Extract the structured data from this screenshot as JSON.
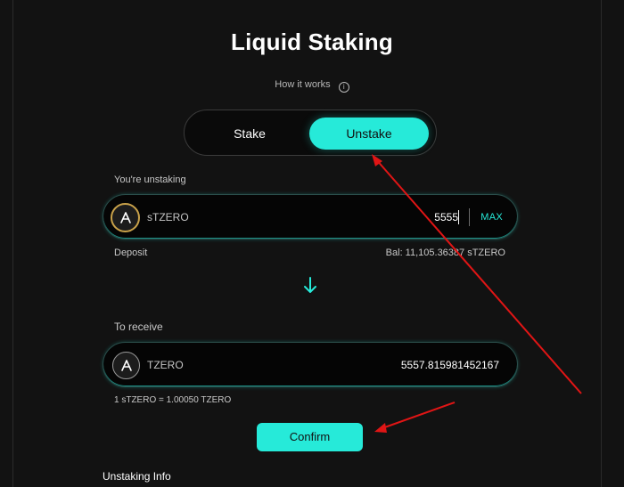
{
  "page": {
    "title": "Liquid Staking",
    "how_it_works": "How it works",
    "info_icon": "i"
  },
  "toggle": {
    "stake_label": "Stake",
    "unstake_label": "Unstake",
    "active": "Unstake"
  },
  "unstake_field": {
    "label": "You're unstaking",
    "token": "sTZERO",
    "value": "5555",
    "max_label": "MAX",
    "footer_left": "Deposit",
    "footer_right": "Bal: 11,105.36387 sTZERO"
  },
  "receive_field": {
    "label": "To receive",
    "token": "TZERO",
    "value": "5557.815981452167",
    "rate": "1 sTZERO = 1.00050 TZERO"
  },
  "confirm_label": "Confirm",
  "section_title": "Unstaking Info",
  "colors": {
    "accent": "#26ead9",
    "background": "#121212",
    "annotation": "#e01515"
  },
  "icons": [
    "info-icon",
    "aptos-token-icon",
    "arrow-down-icon"
  ]
}
